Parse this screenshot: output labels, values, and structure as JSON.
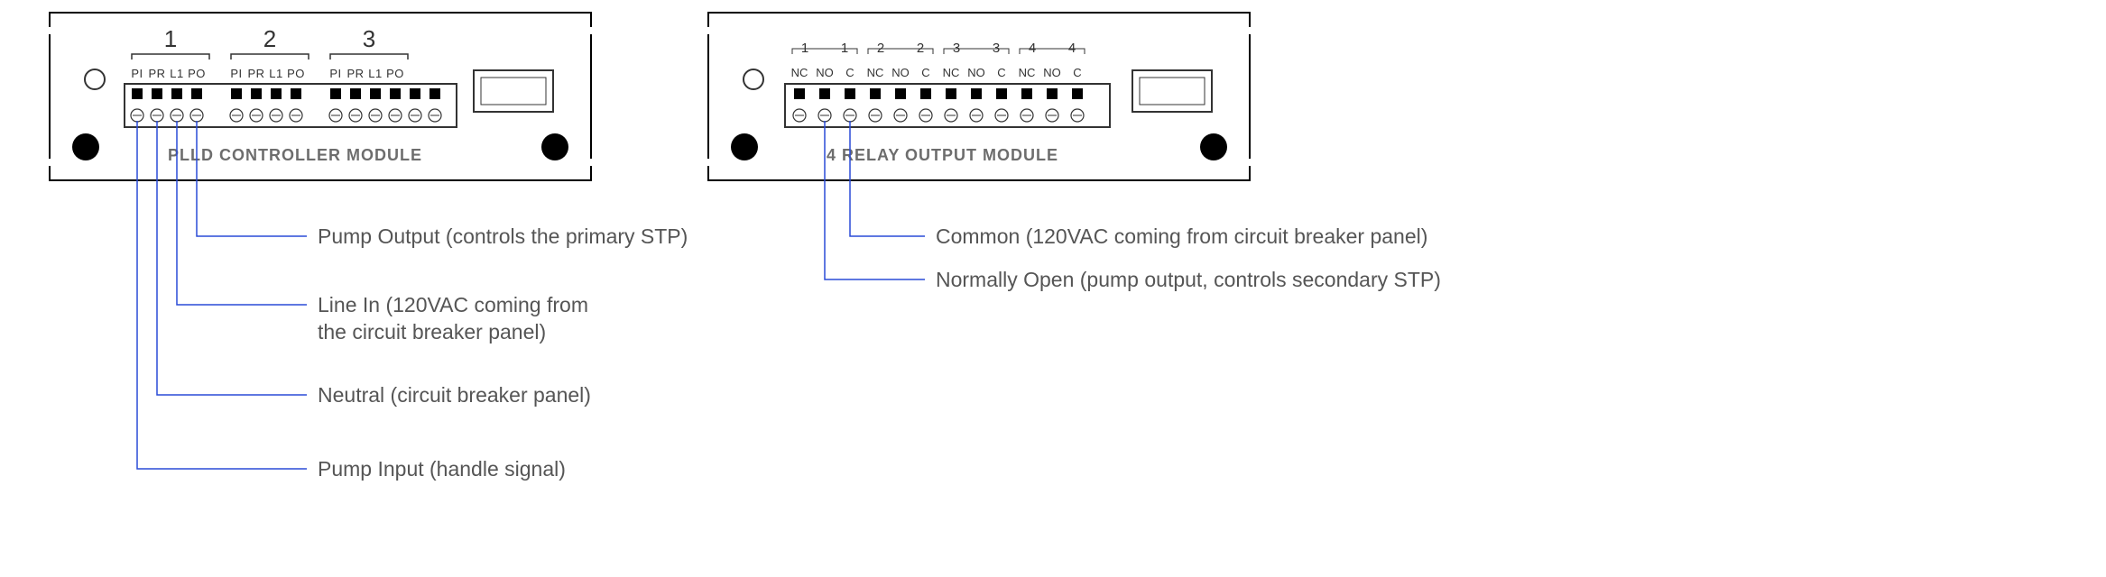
{
  "left_module": {
    "title": "PLLD CONTROLLER MODULE",
    "groups": [
      "1",
      "2",
      "3"
    ],
    "pin_labels": [
      "PI",
      "PR",
      "L1",
      "PO"
    ],
    "callouts": [
      {
        "id": "pump-output",
        "text": "Pump Output (controls the primary STP)"
      },
      {
        "id": "line-in-1",
        "text": "Line In (120VAC coming from"
      },
      {
        "id": "line-in-2",
        "text": "the circuit breaker panel)"
      },
      {
        "id": "neutral",
        "text": "Neutral (circuit breaker panel)"
      },
      {
        "id": "pump-input",
        "text": "Pump Input (handle signal)"
      }
    ]
  },
  "right_module": {
    "title": "4 RELAY OUTPUT MODULE",
    "relay_labels": [
      "1",
      "1",
      "2",
      "2",
      "3",
      "3",
      "4",
      "4"
    ],
    "pin_labels": [
      "NC",
      "NO",
      "C"
    ],
    "callouts": [
      {
        "id": "common",
        "text": "Common (120VAC coming from circuit breaker panel)"
      },
      {
        "id": "normally-open",
        "text": "Normally Open (pump output, controls secondary STP)"
      }
    ]
  }
}
